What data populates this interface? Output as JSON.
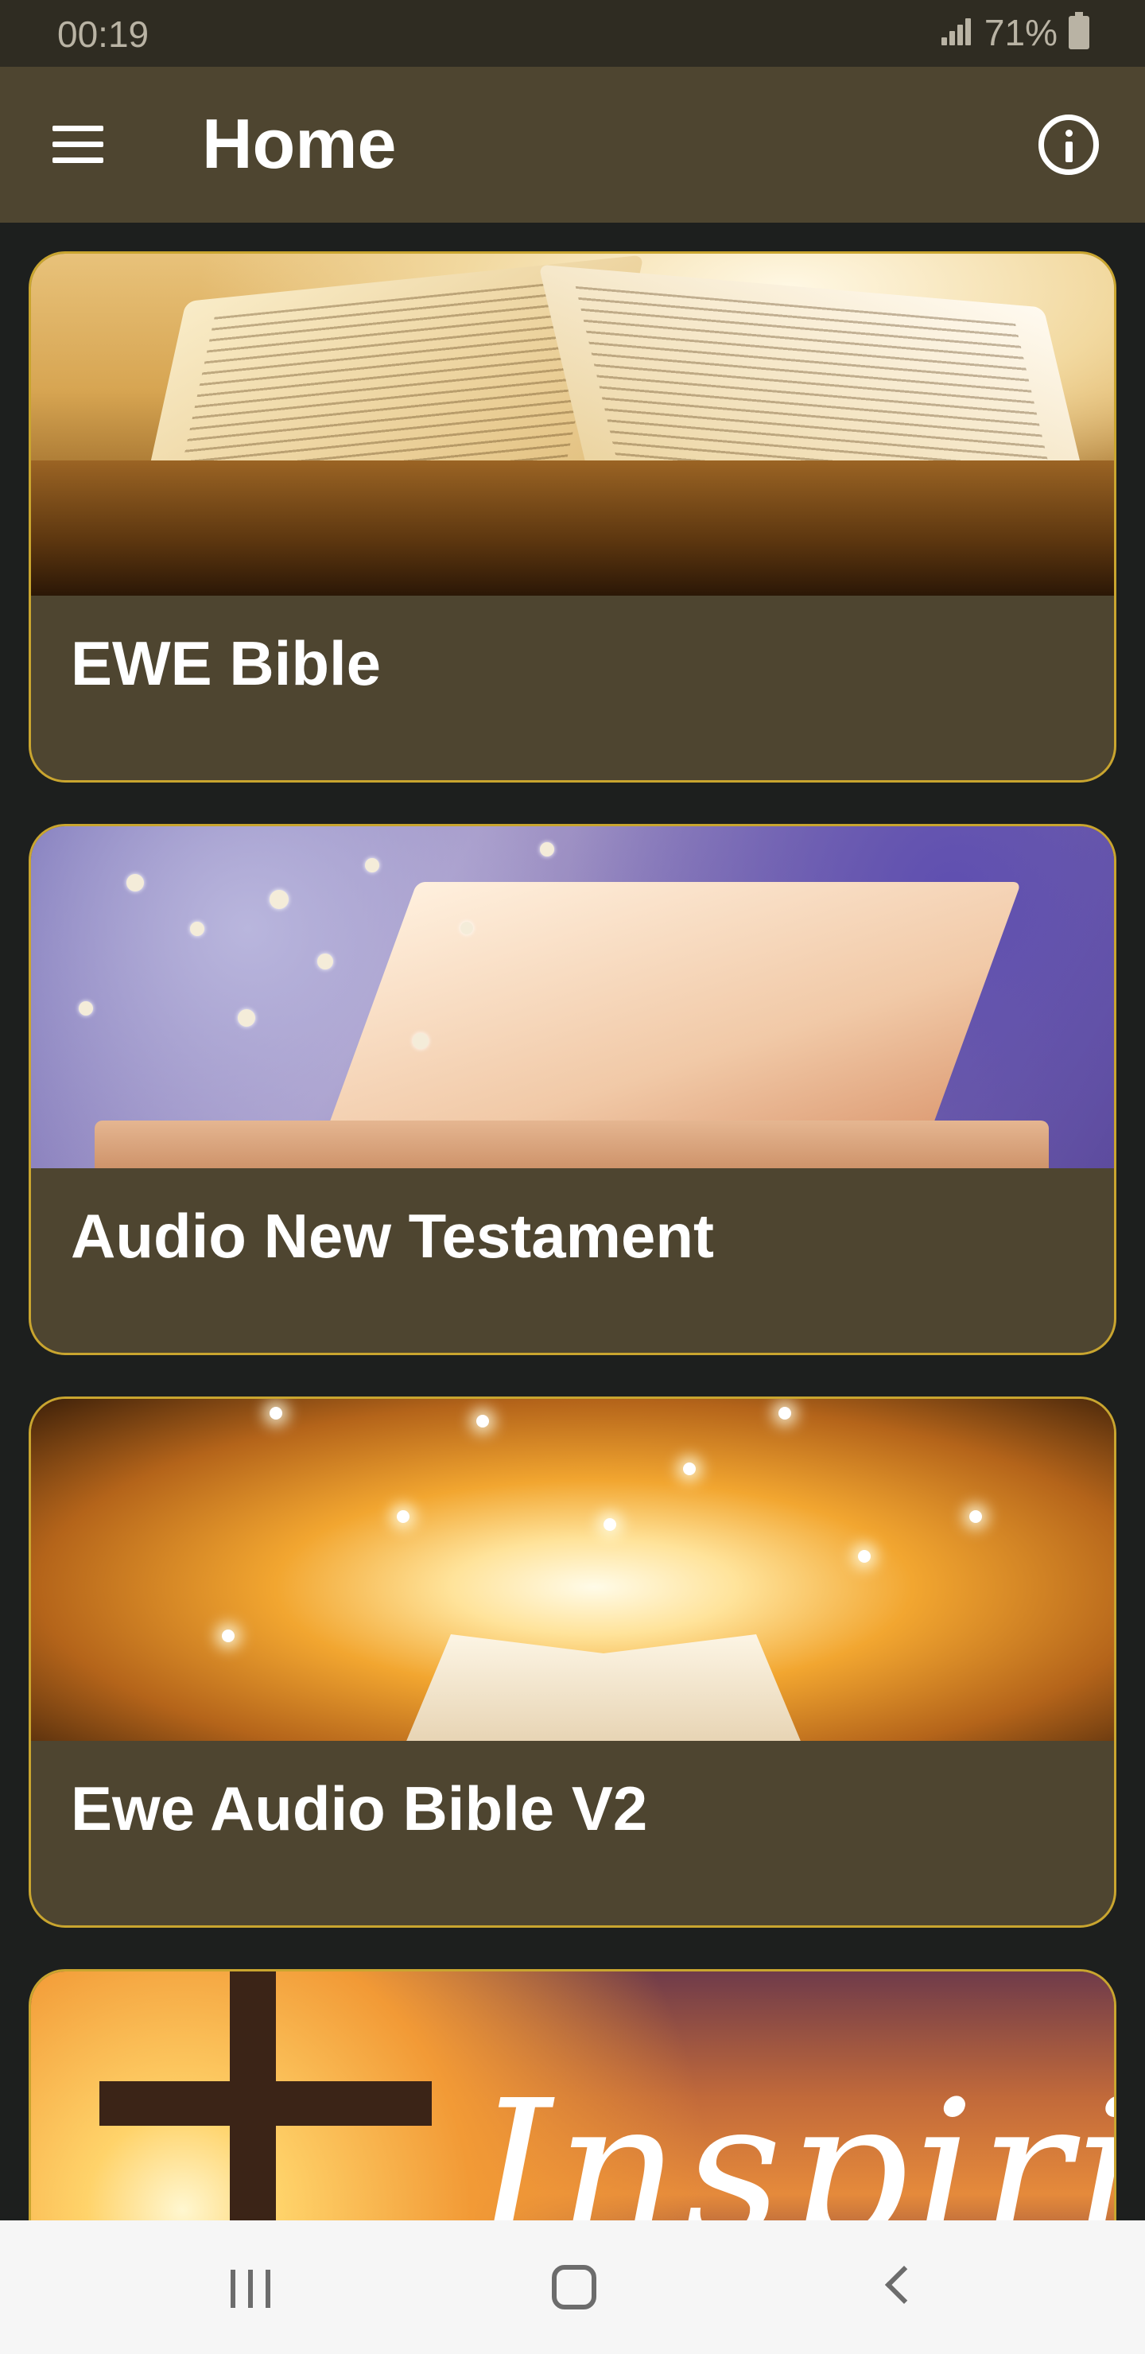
{
  "status_bar": {
    "time": "00:19",
    "battery": "71%"
  },
  "app_bar": {
    "title": "Home"
  },
  "cards": [
    {
      "label": "EWE Bible",
      "image": "open-bible-photo"
    },
    {
      "label": "Audio New Testament",
      "image": "flowers-and-book-photo"
    },
    {
      "label": "Ewe Audio Bible V2",
      "image": "glowing-bible-photo"
    },
    {
      "label": "",
      "image": "cross-sunset-photo",
      "image_text": "Inspiring"
    }
  ],
  "colors": {
    "app_bar": "#4e4530",
    "card_border": "#c9a52f",
    "background": "#1d1f1e",
    "status_bar": "#2f2c22"
  }
}
